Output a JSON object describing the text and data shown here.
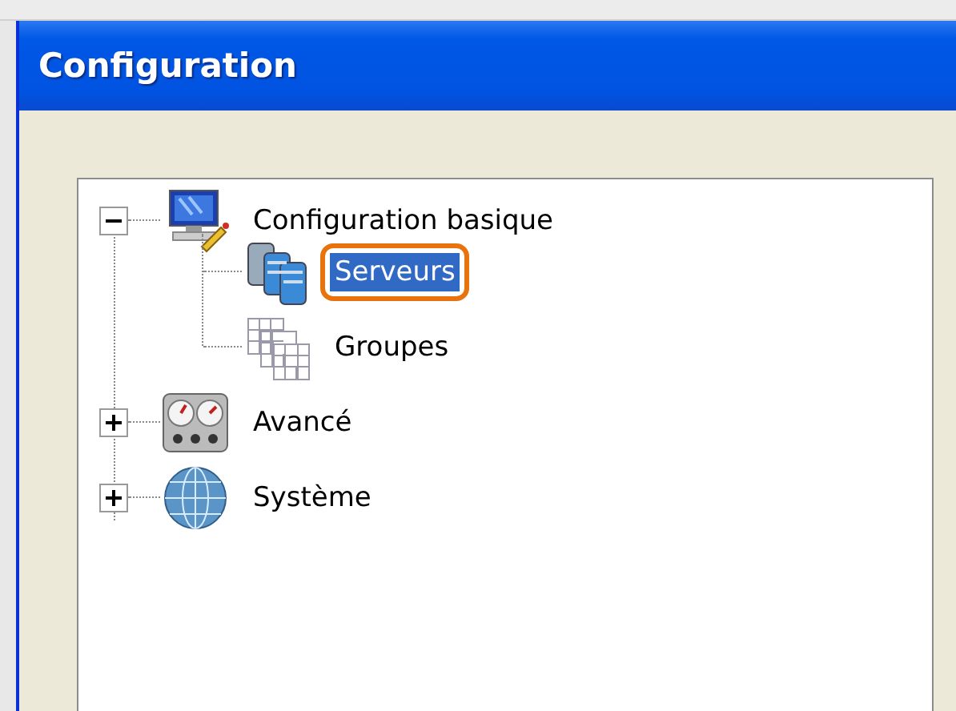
{
  "window": {
    "title": "Configuration"
  },
  "tree": [
    {
      "label": "Configuration basique",
      "kind": "monitor",
      "expanded": true,
      "selected": false,
      "highlighted": false,
      "children": [
        {
          "label": "Serveurs",
          "kind": "servers",
          "selected": true,
          "highlighted": true
        },
        {
          "label": "Groupes",
          "kind": "grid",
          "selected": false,
          "highlighted": false
        }
      ]
    },
    {
      "label": "Avancé",
      "kind": "gauges",
      "expanded": false,
      "selected": false,
      "highlighted": false
    },
    {
      "label": "Système",
      "kind": "globe",
      "expanded": false,
      "selected": false,
      "highlighted": false
    }
  ]
}
